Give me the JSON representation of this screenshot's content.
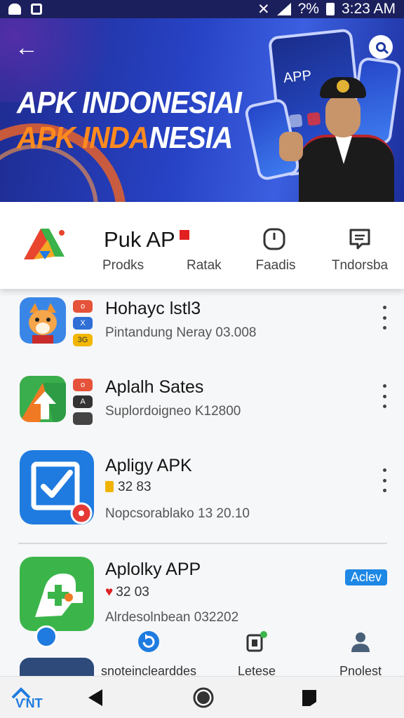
{
  "status_bar": {
    "time": "3:23 AM",
    "battery": "?%"
  },
  "banner": {
    "title_line1": "APK INDONESIAI",
    "title_line2_orange": "APK INDA",
    "title_line2_white": "NESIA",
    "phone_label": "APP"
  },
  "app_header": {
    "name": "Puk AP",
    "meta1": "Prodks",
    "meta2": "Ratak",
    "action1_label": "Faadis",
    "action2_label": "Tndorsba"
  },
  "list": [
    {
      "title": "Hohayc lstl3",
      "subtitle": "Pintandung Neray 03.008",
      "mini1": "o",
      "mini2": "X",
      "mini3": "3G"
    },
    {
      "title": "Aplalh Sates",
      "subtitle": "Suplordoigneo K12800",
      "mini1": "o",
      "mini2": "A"
    },
    {
      "title": "Apligy APK",
      "price": "32 83",
      "subtitle": "Nopcsorablako 13 20.10"
    },
    {
      "title": "Aplolky APP",
      "price": "32 03",
      "subtitle": "Alrdesolnbean 032202",
      "badge": "Aclev"
    }
  ],
  "tabs": [
    {
      "label": "snoteinclearddes"
    },
    {
      "label": "Letese"
    },
    {
      "label": "Pnolest"
    }
  ],
  "colors": {
    "brand_blue": "#2742c4",
    "accent_orange": "#ff8a1f",
    "active_badge": "#1e88e5"
  }
}
